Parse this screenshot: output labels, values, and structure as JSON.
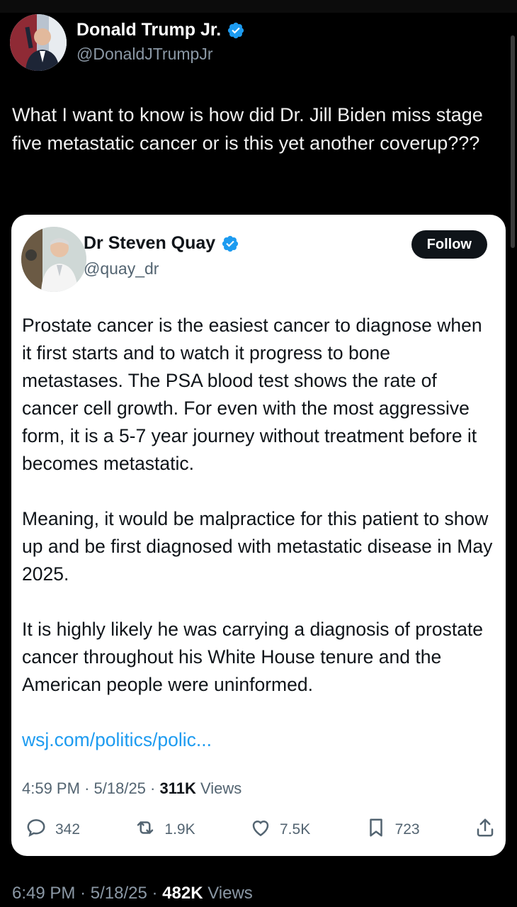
{
  "outer_tweet": {
    "author_name": "Donald Trump Jr.",
    "author_handle": "@DonaldJTrumpJr",
    "text": "What I want to know is how did Dr. Jill Biden miss stage five metastatic cancer or is this yet another coverup???",
    "time": "6:49 PM",
    "date": "5/18/25",
    "views_count": "482K",
    "views_label": "Views",
    "sep": "·"
  },
  "quoted_tweet": {
    "author_name": "Dr Steven Quay",
    "author_handle": "@quay_dr",
    "follow_label": "Follow",
    "paragraphs": [
      "Prostate cancer is the easiest cancer to diagnose when it first starts and to watch it progress to bone metastases. The PSA blood test shows the rate of cancer cell growth. For even with the most aggressive form, it is a 5-7 year journey without treatment before it becomes metastatic.",
      "Meaning, it would be malpractice for this patient to show up and be first diagnosed with metastatic disease in May 2025.",
      "It is highly likely he was carrying a diagnosis of prostate cancer throughout his White House tenure and the American people were uninformed."
    ],
    "link": "wsj.com/politics/polic...",
    "time": "4:59 PM",
    "date": "5/18/25",
    "views_count": "311K",
    "views_label": "Views",
    "sep": "·",
    "replies": "342",
    "reposts": "1.9K",
    "likes": "7.5K",
    "bookmarks": "723"
  },
  "icons": {
    "verified": "verified-badge-icon",
    "reply": "reply-icon",
    "repost": "repost-icon",
    "like": "heart-icon",
    "bookmark": "bookmark-icon",
    "share": "share-icon"
  },
  "colors": {
    "verified": "#1d9bf0",
    "link": "#1d9bf0",
    "follow_bg": "#0f1419"
  }
}
